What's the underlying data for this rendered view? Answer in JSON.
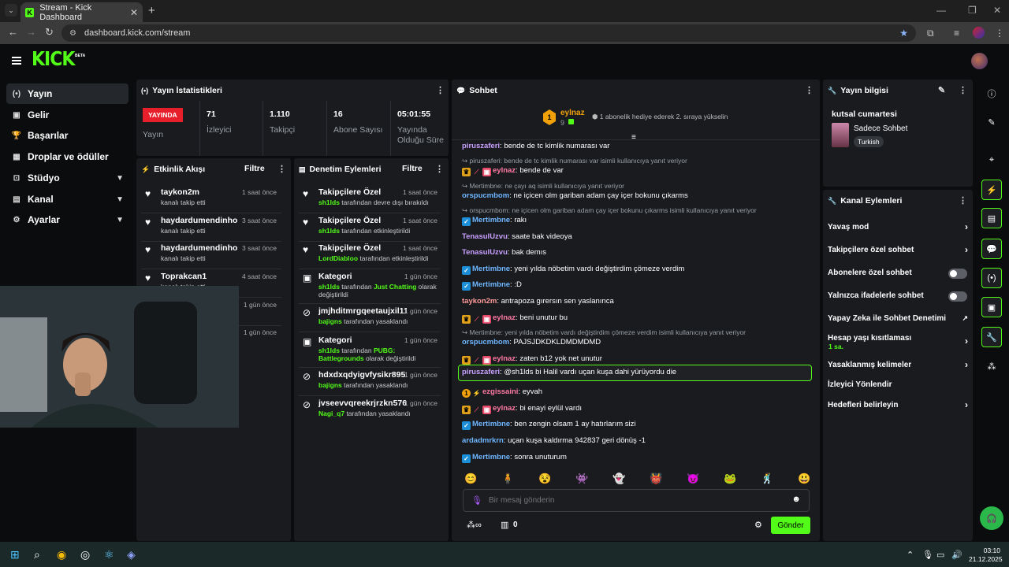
{
  "browser": {
    "tab_title": "Stream - Kick Dashboard",
    "url": "dashboard.kick.com/stream",
    "new_tab": "+",
    "close": "✕",
    "favicon": "K"
  },
  "brand": {
    "logo": "KICK",
    "beta": "BETA",
    "accent": "#53fc18"
  },
  "sidebar": {
    "items": [
      {
        "label": "Yayın",
        "icon": "broadcast-icon",
        "glyph": "(•)"
      },
      {
        "label": "Gelir",
        "icon": "revenue-icon",
        "glyph": "▣"
      },
      {
        "label": "Başarılar",
        "icon": "trophy-icon",
        "glyph": "🏆"
      },
      {
        "label": "Droplar ve ödüller",
        "icon": "gift-icon",
        "glyph": "▦"
      },
      {
        "label": "Stüdyo",
        "icon": "studio-icon",
        "glyph": "⊡"
      },
      {
        "label": "Kanal",
        "icon": "channel-icon",
        "glyph": "▤"
      },
      {
        "label": "Ayarlar",
        "icon": "settings-icon",
        "glyph": "⚙"
      }
    ]
  },
  "stats": {
    "title": "Yayın İstatistikleri",
    "live_badge": "YAYINDA",
    "live_label": "Yayın",
    "items": [
      {
        "value": "71",
        "label": "İzleyici"
      },
      {
        "value": "1.110",
        "label": "Takipçi"
      },
      {
        "value": "16",
        "label": "Abone Sayısı"
      },
      {
        "value": "05:01:55",
        "label": "Yayında Olduğu Süre"
      }
    ]
  },
  "activity": {
    "title": "Etkinlik Akışı",
    "filter": "Filtre",
    "items": [
      {
        "name": "taykon2m",
        "sub": "kanalı takip etti",
        "time": "1 saat önce"
      },
      {
        "name": "haydardumendinho",
        "sub": "kanalı takip etti",
        "time": "3 saat önce"
      },
      {
        "name": "haydardumendinho",
        "sub": "kanalı takip etti",
        "time": "3 saat önce"
      },
      {
        "name": "Toprakcan1",
        "sub": "kanalı takip etti",
        "time": "4 saat önce"
      },
      {
        "name": "",
        "sub": "",
        "time": "1 gün önce"
      },
      {
        "name": "",
        "sub": "",
        "time": "1 gün önce"
      }
    ]
  },
  "moderation": {
    "title": "Denetim Eylemleri",
    "filter": "Filtre",
    "items": [
      {
        "title": "Takipçilere Özel",
        "user": "sh1lds",
        "rest": " tarafından devre dışı bırakıldı",
        "time": "1 saat önce"
      },
      {
        "title": "Takipçilere Özel",
        "user": "sh1lds",
        "rest": " tarafından etkinleştirildi",
        "time": "1 saat önce"
      },
      {
        "title": "Takipçilere Özel",
        "user": "LordDiabloo",
        "rest": " tarafından etkinleştirildi",
        "time": "1 saat önce"
      },
      {
        "title": "Kategori",
        "user": "sh1lds",
        "rest": " tarafından ",
        "cat": "Just Chatting",
        "rest2": " olarak değiştirildi",
        "time": "1 gün önce"
      },
      {
        "title": "jmjhditmrgqeetaujxil1184",
        "user": "bajigns",
        "rest": " tarafından yasaklandı",
        "time": "1 gün önce"
      },
      {
        "title": "Kategori",
        "user": "sh1lds",
        "rest": " tarafından ",
        "cat": "PUBG: Battlegrounds",
        "rest2": " olarak değiştirildi",
        "time": "1 gün önce"
      },
      {
        "title": "hdxdxqdyigvfysikr8951",
        "user": "bajigns",
        "rest": " tarafından yasaklandı",
        "time": "1 gün önce"
      },
      {
        "title": "jvseevvqreekrjrzkn576",
        "user": "Nagi_q7",
        "rest": " tarafından yasaklandı",
        "time": "1 gün önce"
      }
    ]
  },
  "chat": {
    "title": "Sohbet",
    "pinned_user": "eylnaz",
    "pinned_count": "9",
    "pinned_rank": "1",
    "gift_text": "1 abonelik hediye ederek 2. sıraya yükselin",
    "messages": [
      {
        "type": "msg",
        "user": "piruszaferi",
        "color": "#c9a0ff",
        "text": "bende de tc kimlik numarası var"
      },
      {
        "type": "reply",
        "text": "piruszaferi: bende de tc kimlik numarası var isimli kullanıcıya yanıt veriyor"
      },
      {
        "type": "msg",
        "badges": "csh",
        "user": "eylnaz",
        "color": "#ff7aa2",
        "text": "bende de var"
      },
      {
        "type": "reply",
        "text": "Mertimbne: ne çayı aq isimli kullanıcıya yanıt veriyor"
      },
      {
        "type": "msg",
        "user": "orspucmbom",
        "color": "#6fb6ff",
        "text": "ne içicen olm gariban adam çay içer bokunu çıkarms"
      },
      {
        "type": "reply",
        "text": "orspucmbom: ne içicen olm gariban adam çay içer bokunu çıkarms isimli kullanıcıya yanıt veriyor"
      },
      {
        "type": "msg",
        "badges": "v",
        "user": "Mertimbne",
        "color": "#6fb6ff",
        "text": "rakı"
      },
      {
        "type": "msg",
        "user": "TenasulUzvu",
        "color": "#c9a0ff",
        "text": "saate bak videoya"
      },
      {
        "type": "msg",
        "user": "TenasulUzvu",
        "color": "#c9a0ff",
        "text": "bak demıs"
      },
      {
        "type": "msg",
        "badges": "v",
        "user": "Mertimbne",
        "color": "#6fb6ff",
        "text": "yeni yılda nöbetim vardı değiştirdim çömeze verdim"
      },
      {
        "type": "msg",
        "badges": "v",
        "user": "Mertimbne",
        "color": "#6fb6ff",
        "text": ":D"
      },
      {
        "type": "msg",
        "user": "taykon2m",
        "color": "#ff9a9a",
        "text": "antrapoza gırersın sen yaslanınca"
      },
      {
        "type": "msg",
        "badges": "csh",
        "user": "eylnaz",
        "color": "#ff7aa2",
        "text": "beni unutur bu"
      },
      {
        "type": "reply",
        "text": "Mertimbne: yeni yılda nöbetim vardı değiştirdim çömeze verdim isimli kullanıcıya yanıt veriyor"
      },
      {
        "type": "msg",
        "user": "orspucmbom",
        "color": "#6fb6ff",
        "text": "PAJSJDKDKLDMDMDMD"
      },
      {
        "type": "msg",
        "badges": "csh",
        "user": "eylnaz",
        "color": "#ff7aa2",
        "text": "zaten b12 yok net unutur"
      },
      {
        "type": "hl",
        "user": "piruszaferi",
        "color": "#c9a0ff",
        "text": "@sh1lds bi Halil vardı uçan kuşa dahi yürüyordu die"
      },
      {
        "type": "msg",
        "badges": "og",
        "user": "ezgissaini",
        "color": "#ff7aa2",
        "text": "eyvah"
      },
      {
        "type": "msg",
        "badges": "csh",
        "user": "eylnaz",
        "color": "#ff7aa2",
        "text": "bi enayi eylül vardı"
      },
      {
        "type": "msg",
        "badges": "v",
        "user": "Mertimbne",
        "color": "#6fb6ff",
        "text": "ben zengin olsam 1 ay hatırlarım sizi"
      },
      {
        "type": "msg",
        "user": "ardadmrkrn",
        "color": "#6fb6ff",
        "text": "uçan kuşa kaldırma 942837 geri dönüş -1"
      },
      {
        "type": "msg",
        "badges": "v",
        "user": "Mertimbne",
        "color": "#6fb6ff",
        "text": "sonra unuturum"
      }
    ],
    "emotes": [
      "😊",
      "🧍",
      "😵",
      "👾",
      "👻",
      "👹",
      "😈",
      "🐸",
      "🕺",
      "😃"
    ],
    "input_placeholder": "Bir mesaj gönderin",
    "points": "0",
    "send_label": "Gönder"
  },
  "stream_info": {
    "title": "Yayın bilgisi",
    "stream_title": "kutsal cumartesi",
    "chat_mode": "Sadece Sohbet",
    "tag": "Turkish"
  },
  "channel_actions": {
    "title": "Kanal Eylemleri",
    "items": [
      {
        "label": "Yavaş mod",
        "kind": "chevron"
      },
      {
        "label": "Takipçilere özel sohbet",
        "kind": "chevron"
      },
      {
        "label": "Abonelere özel sohbet",
        "kind": "toggle"
      },
      {
        "label": "Yalnızca ifadelerle sohbet",
        "kind": "toggle"
      },
      {
        "label": "Yapay Zeka ile Sohbet Denetimi",
        "kind": "external"
      },
      {
        "label": "Hesap yaşı kısıtlaması",
        "sub": "1 sa.",
        "kind": "chevron"
      },
      {
        "label": "Yasaklanmış kelimeler",
        "kind": "chevron"
      },
      {
        "label": "İzleyici Yönlendir",
        "kind": "none"
      },
      {
        "label": "Hedefleri belirleyin",
        "kind": "chevron"
      }
    ]
  },
  "taskbar": {
    "time": "03:10",
    "date": "21.12.2025"
  }
}
